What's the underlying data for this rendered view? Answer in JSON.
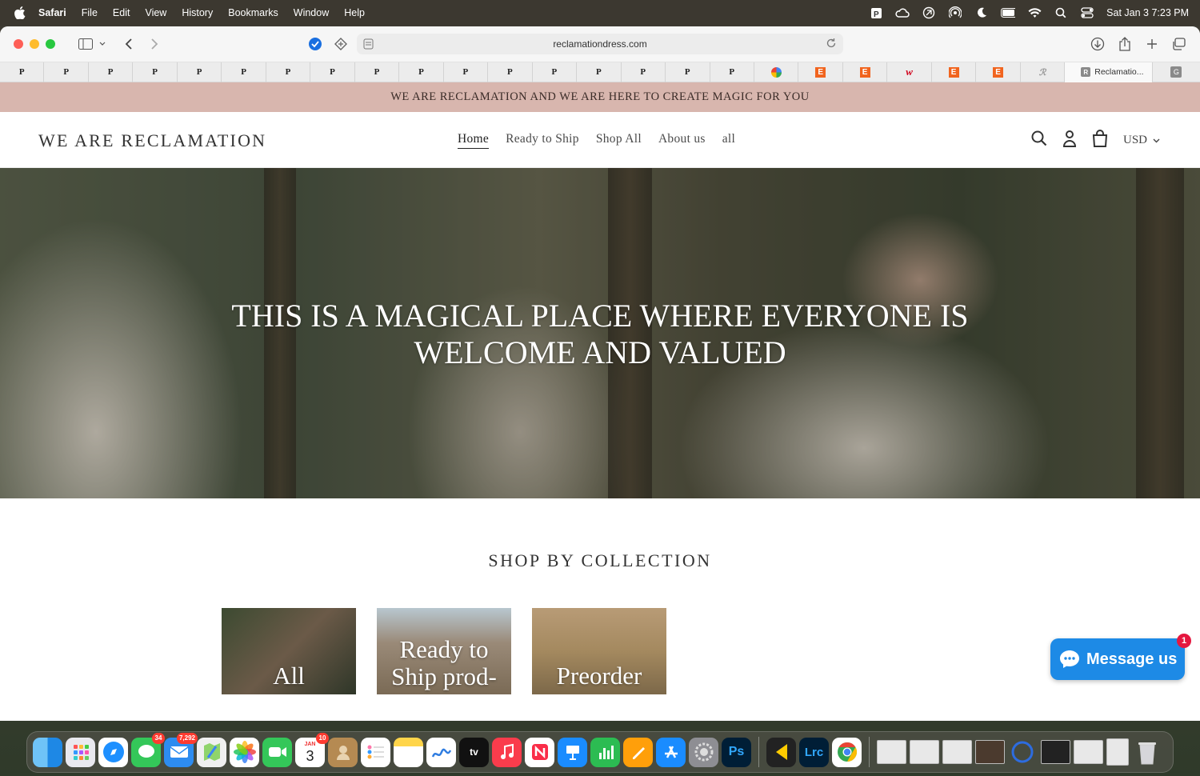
{
  "menubar": {
    "app": "Safari",
    "items": [
      "File",
      "Edit",
      "View",
      "History",
      "Bookmarks",
      "Window",
      "Help"
    ],
    "clock": "Sat Jan 3  7:23 PM",
    "status_icons": [
      "pandora-icon",
      "cloud-icon",
      "vpn-icon",
      "airdrop-icon",
      "focus-moon-icon",
      "battery-icon",
      "wifi-icon",
      "spotlight-icon",
      "control-center-icon"
    ]
  },
  "browser": {
    "url": "reclamationdress.com",
    "favorites": [
      "P",
      "P",
      "P",
      "P",
      "P",
      "P",
      "P",
      "P",
      "P",
      "P",
      "P",
      "P",
      "P",
      "P",
      "P",
      "P",
      "P"
    ],
    "active_tab": {
      "icon_letter": "R",
      "title": "Reclamatio..."
    },
    "last_tab": {
      "icon_letter": "G"
    }
  },
  "site": {
    "announcement": "WE ARE RECLAMATION AND WE ARE HERE TO CREATE MAGIC FOR YOU",
    "logo": "WE ARE RECLAMATION",
    "nav": [
      "Home",
      "Ready to Ship",
      "Shop All",
      "About us",
      "all"
    ],
    "currency": "USD",
    "hero_line1": "THIS IS A MAGICAL PLACE WHERE EVERYONE IS",
    "hero_line2": "WELCOME AND VALUED",
    "collection_title": "SHOP BY COLLECTION",
    "collections": [
      {
        "line1": "All",
        "line2": ""
      },
      {
        "line1": "Ready to",
        "line2": "Ship prod-"
      },
      {
        "line1": "Preorder",
        "line2": ""
      }
    ]
  },
  "chat": {
    "label": "Message us",
    "badge": "1"
  },
  "dock": {
    "badges": {
      "messages": "34",
      "mail": "7,292",
      "calendar": "10"
    },
    "calendar_day": "3",
    "calendar_month": "JAN",
    "tv_label": "tv",
    "ps_label": "Ps",
    "lrc_label": "Lrc"
  },
  "colors": {
    "announce_bg": "#d8b6ae",
    "chat_blue": "#1d8ae6"
  }
}
